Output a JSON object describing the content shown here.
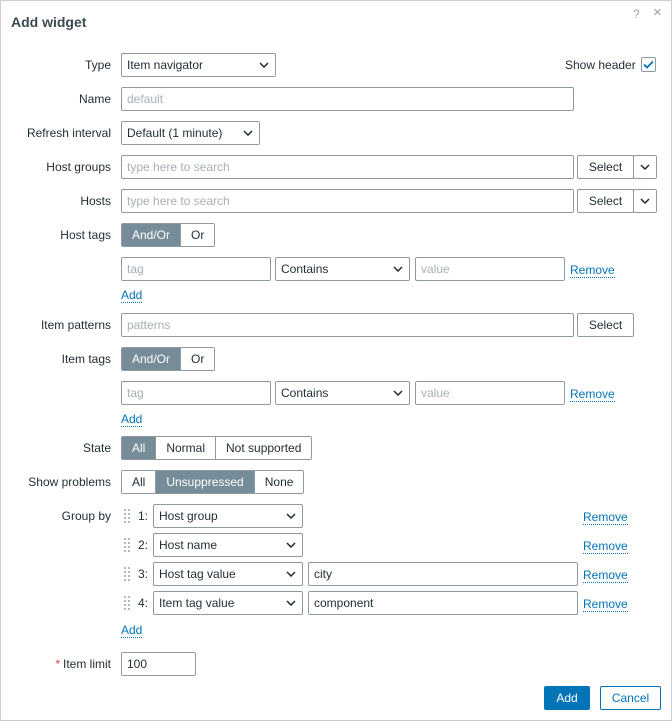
{
  "dialog": {
    "title": "Add widget",
    "help_icon": "?",
    "close_icon": "×"
  },
  "type": {
    "label": "Type",
    "value": "Item navigator"
  },
  "show_header": {
    "label": "Show header",
    "checked": true
  },
  "name": {
    "label": "Name",
    "placeholder": "default"
  },
  "refresh": {
    "label": "Refresh interval",
    "value": "Default (1 minute)"
  },
  "host_groups": {
    "label": "Host groups",
    "placeholder": "type here to search",
    "select_label": "Select"
  },
  "hosts": {
    "label": "Hosts",
    "placeholder": "type here to search",
    "select_label": "Select"
  },
  "host_tags": {
    "label": "Host tags",
    "options": [
      "And/Or",
      "Or"
    ],
    "selected": "And/Or",
    "row": {
      "tag_placeholder": "tag",
      "operator": "Contains",
      "value_placeholder": "value",
      "remove_label": "Remove"
    },
    "add_label": "Add"
  },
  "item_patterns": {
    "label": "Item patterns",
    "placeholder": "patterns",
    "select_label": "Select"
  },
  "item_tags": {
    "label": "Item tags",
    "options": [
      "And/Or",
      "Or"
    ],
    "selected": "And/Or",
    "row": {
      "tag_placeholder": "tag",
      "operator": "Contains",
      "value_placeholder": "value",
      "remove_label": "Remove"
    },
    "add_label": "Add"
  },
  "state": {
    "label": "State",
    "options": [
      "All",
      "Normal",
      "Not supported"
    ],
    "selected": "All"
  },
  "show_problems": {
    "label": "Show problems",
    "options": [
      "All",
      "Unsuppressed",
      "None"
    ],
    "selected": "Unsuppressed"
  },
  "group_by": {
    "label": "Group by",
    "rows": [
      {
        "index": "1:",
        "attribute": "Host group",
        "tag": ""
      },
      {
        "index": "2:",
        "attribute": "Host name",
        "tag": ""
      },
      {
        "index": "3:",
        "attribute": "Host tag value",
        "tag": "city"
      },
      {
        "index": "4:",
        "attribute": "Item tag value",
        "tag": "component"
      }
    ],
    "remove_label": "Remove",
    "add_label": "Add"
  },
  "item_limit": {
    "label": "Item limit",
    "required_marker": "*",
    "value": "100"
  },
  "footer": {
    "add_label": "Add",
    "cancel_label": "Cancel"
  },
  "colors": {
    "accent": "#0275b8",
    "segment_active": "#768d99",
    "border": "#8e9aa1",
    "placeholder": "#a6b0b6"
  }
}
